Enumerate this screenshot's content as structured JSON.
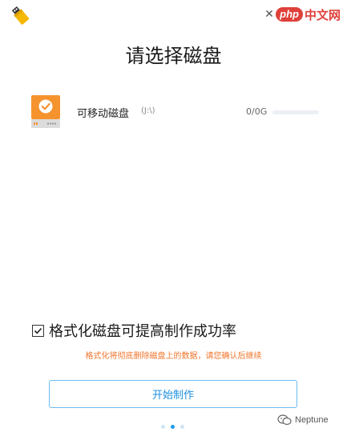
{
  "app": {
    "icon": "usb-drive-icon",
    "close_symbol": "✕"
  },
  "watermark_top": {
    "brand": "php",
    "suffix": "中文网"
  },
  "title": "请选择磁盘",
  "disk": {
    "icon": "removable-disk-check-icon",
    "name": "可移动磁盘",
    "letter": "(J:\\)",
    "size": "0/0G",
    "usage_fraction": 0
  },
  "format_option": {
    "checked": true,
    "label": "格式化磁盘可提高制作成功率"
  },
  "warning": "格式化将彻底删除磁盘上的数据，请您确认后继续",
  "start_button": "开始制作",
  "pager": {
    "count": 3,
    "active_index": 1
  },
  "watermark_bottom": {
    "icon": "wechat-icon",
    "text": "Neptune"
  },
  "colors": {
    "accent": "#1f9bea",
    "warning": "#f0742a",
    "disk_orange": "#f5932f"
  }
}
